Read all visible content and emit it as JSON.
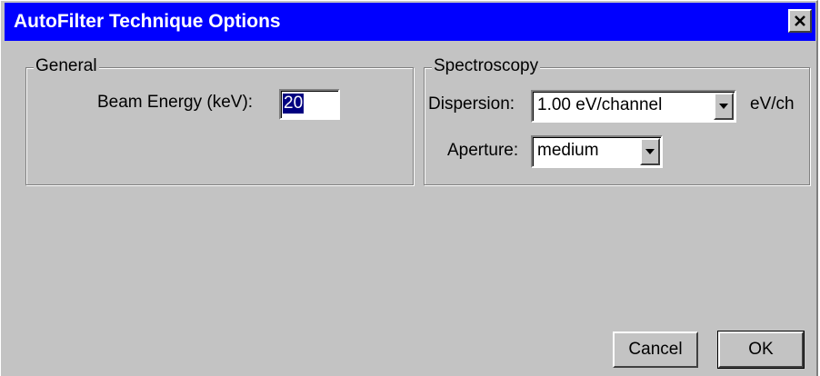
{
  "window": {
    "title": "AutoFilter Technique Options",
    "close_icon": "close-icon"
  },
  "general": {
    "group_label": "General",
    "beam_energy_label": "Beam Energy (keV):",
    "beam_energy_value": "20"
  },
  "spectroscopy": {
    "group_label": "Spectroscopy",
    "dispersion_label": "Dispersion:",
    "dispersion_value": "1.00 eV/channel",
    "dispersion_unit": "eV/ch",
    "aperture_label": "Aperture:",
    "aperture_value": "medium"
  },
  "buttons": {
    "cancel_label": "Cancel",
    "ok_label": "OK"
  },
  "colors": {
    "titlebar": "#0000ff",
    "face": "#c3c3c3",
    "selection": "#000080"
  }
}
